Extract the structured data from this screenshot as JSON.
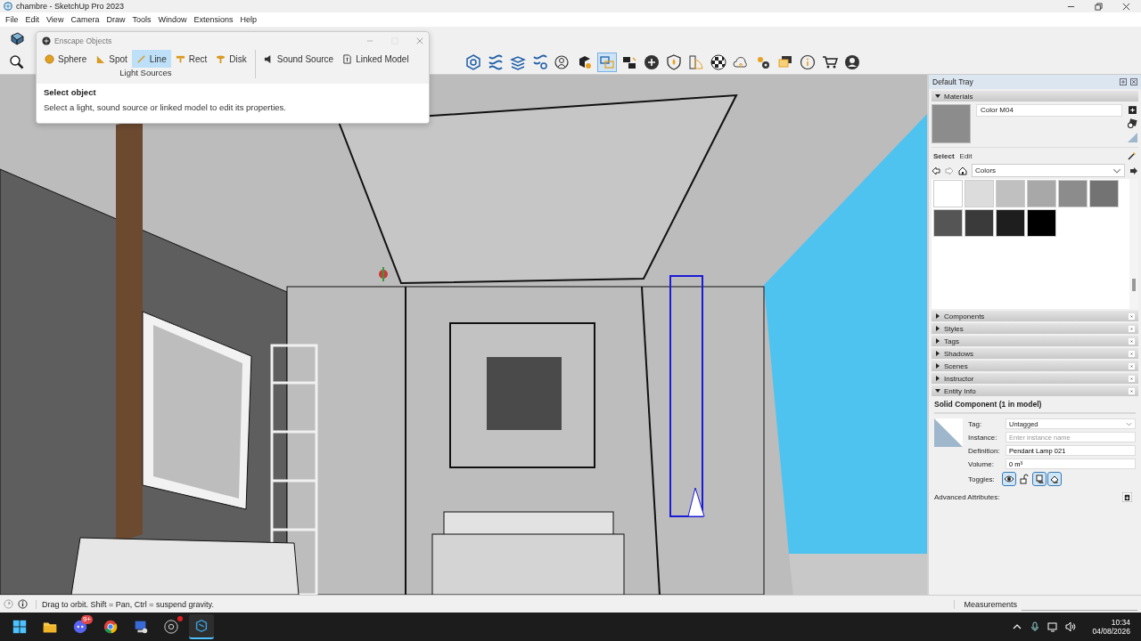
{
  "window": {
    "title": "chambre - SketchUp Pro 2023"
  },
  "menu": [
    "File",
    "Edit",
    "View",
    "Camera",
    "Draw",
    "Tools",
    "Window",
    "Extensions",
    "Help"
  ],
  "toolbar": [
    {
      "kind": "magnifier",
      "selected": false
    },
    {
      "kind": "hex-search",
      "selected": false
    },
    {
      "kind": "wave",
      "selected": false
    },
    {
      "kind": "stack",
      "selected": false
    },
    {
      "kind": "wave-gear",
      "selected": false
    },
    {
      "kind": "user-menu",
      "selected": false
    },
    {
      "kind": "cube-gear",
      "selected": false
    },
    {
      "kind": "swap",
      "selected": true
    },
    {
      "kind": "camera",
      "selected": false
    },
    {
      "kind": "plus-circle",
      "selected": false
    },
    {
      "kind": "shield",
      "selected": false
    },
    {
      "kind": "building",
      "selected": false
    },
    {
      "kind": "checker",
      "selected": false
    },
    {
      "kind": "cloud",
      "selected": false
    },
    {
      "kind": "gears",
      "selected": false
    },
    {
      "kind": "chat",
      "selected": false
    },
    {
      "kind": "info",
      "selected": false
    },
    {
      "kind": "cart",
      "selected": false
    },
    {
      "kind": "person",
      "selected": false
    }
  ],
  "enscape": {
    "title": "Enscape Objects",
    "light_tools": [
      {
        "kind": "sphere",
        "label": "Sphere",
        "selected": false
      },
      {
        "kind": "spot",
        "label": "Spot",
        "selected": false
      },
      {
        "kind": "line",
        "label": "Line",
        "selected": true
      },
      {
        "kind": "rect",
        "label": "Rect",
        "selected": false
      },
      {
        "kind": "disk",
        "label": "Disk",
        "selected": false
      }
    ],
    "group_label": "Light Sources",
    "other_tools": [
      {
        "kind": "speaker",
        "label": "Sound Source"
      },
      {
        "kind": "file",
        "label": "Linked Model"
      }
    ],
    "heading": "Select object",
    "message": "Select a light, sound source or linked model to edit its properties."
  },
  "tray": {
    "title": "Default Tray",
    "materials": {
      "title": "Materials",
      "expanded": true,
      "name": "Color M04",
      "tabs": [
        {
          "label": "Select",
          "selected": true
        },
        {
          "label": "Edit",
          "selected": false
        }
      ],
      "library": "Colors",
      "swatches": [
        {
          "color": "#ffffff"
        },
        {
          "color": "#dcdcdc"
        },
        {
          "color": "#c0c0c0"
        },
        {
          "color": "#a8a8a8"
        },
        {
          "color": "#8c8c8c"
        },
        {
          "color": "#737373"
        },
        {
          "color": "#555555"
        },
        {
          "color": "#3a3a3a"
        },
        {
          "color": "#1e1e1e"
        },
        {
          "color": "#000000"
        }
      ]
    },
    "panels": [
      {
        "title": "Components",
        "expanded": false
      },
      {
        "title": "Styles",
        "expanded": false
      },
      {
        "title": "Tags",
        "expanded": false
      },
      {
        "title": "Shadows",
        "expanded": false
      },
      {
        "title": "Scenes",
        "expanded": false
      },
      {
        "title": "Instructor",
        "expanded": false
      },
      {
        "title": "Entity Info",
        "expanded": true
      }
    ],
    "entity_info": {
      "heading": "Solid Component (1 in model)",
      "fields": [
        {
          "kind": "select",
          "label": "Tag:",
          "value": "Untagged"
        },
        {
          "kind": "input",
          "label": "Instance:",
          "placeholder": "Enter instance name"
        },
        {
          "kind": "input",
          "label": "Definition:",
          "value": "Pendant Lamp 021"
        },
        {
          "kind": "input",
          "label": "Volume:",
          "value": "0 m³"
        }
      ],
      "toggles_label": "Toggles:",
      "toggles": [
        {
          "kind": "eye",
          "selected": true
        },
        {
          "kind": "lock",
          "selected": false
        },
        {
          "kind": "cast",
          "selected": true
        },
        {
          "kind": "receive",
          "selected": true
        }
      ],
      "advanced_label": "Advanced Attributes:"
    }
  },
  "status_bar": {
    "hint": "Drag to orbit. Shift = Pan, Ctrl = suspend gravity.",
    "measurements_label": "Measurements"
  },
  "taskbar": {
    "apps": [
      {
        "kind": "windows",
        "alert": false,
        "active": false
      },
      {
        "kind": "folder",
        "alert": false,
        "active": false
      },
      {
        "kind": "chat",
        "badge": "9+",
        "alert": false,
        "active": false
      },
      {
        "kind": "browser",
        "alert": false,
        "active": false
      },
      {
        "kind": "computer",
        "alert": false,
        "active": false
      },
      {
        "kind": "recorder",
        "alert": true,
        "active": false
      },
      {
        "kind": "sketchup",
        "alert": false,
        "active": true
      }
    ],
    "time": "10:34",
    "date": "04/08/2026"
  }
}
